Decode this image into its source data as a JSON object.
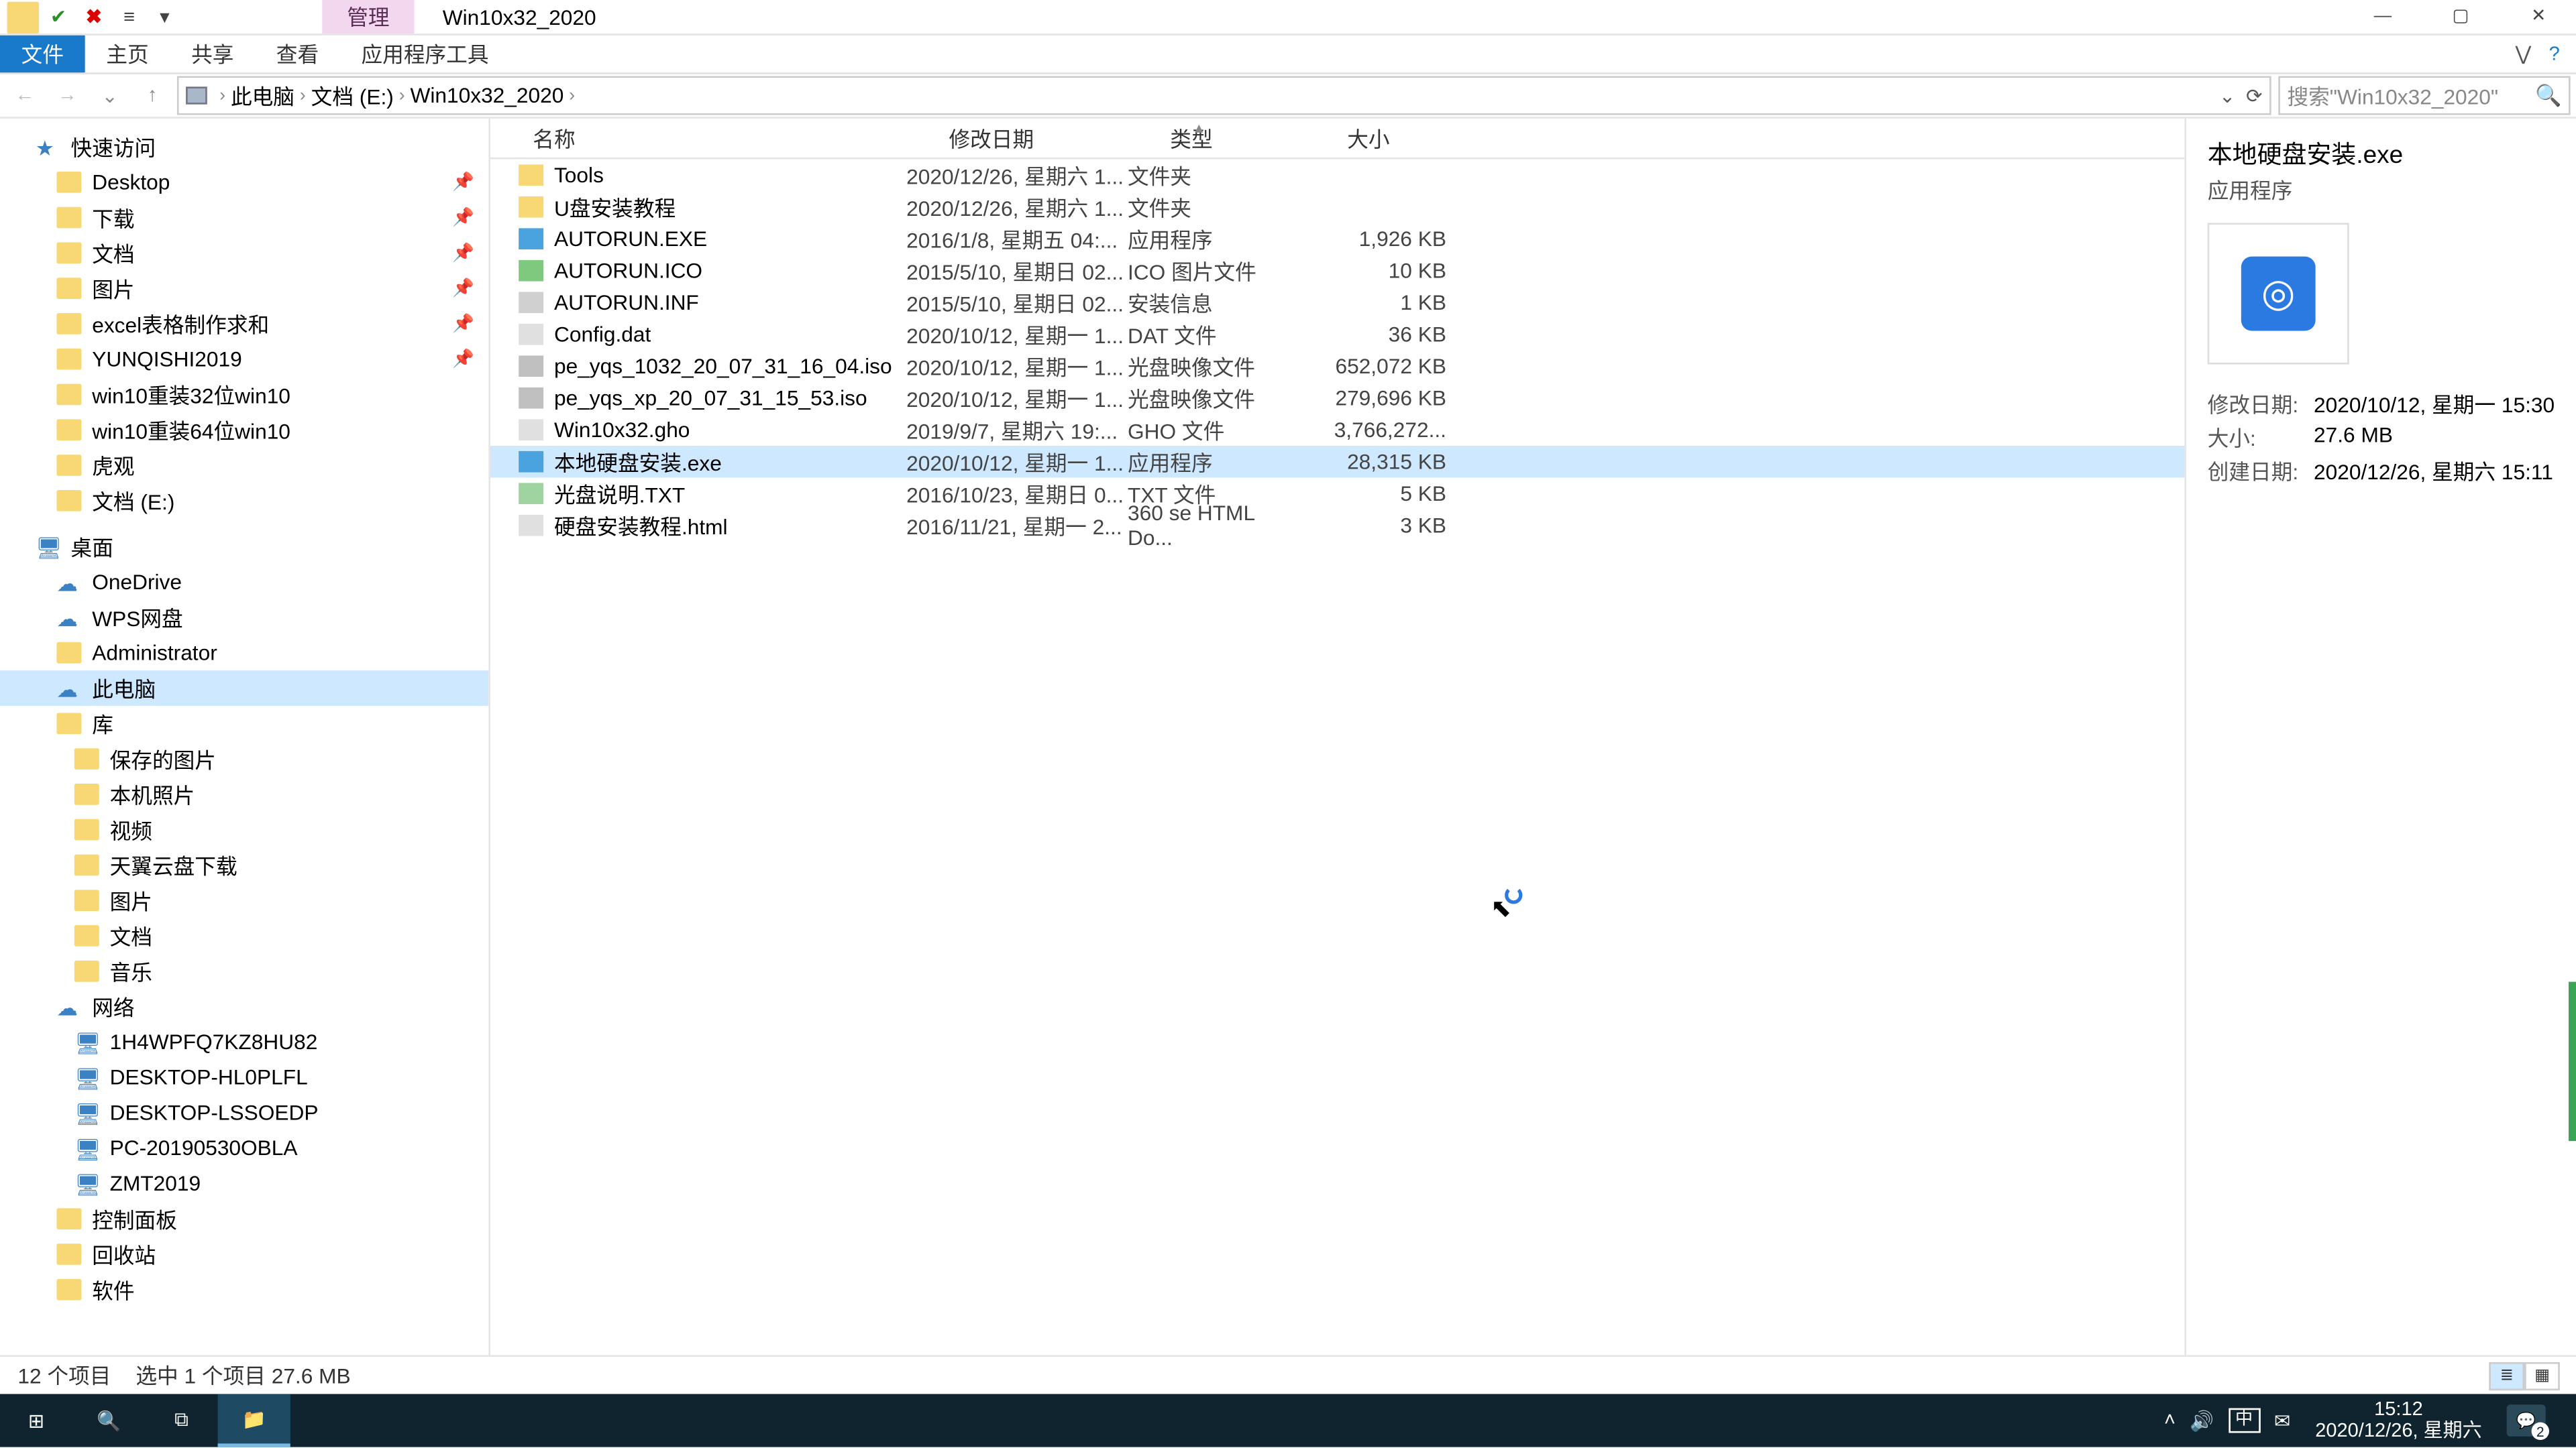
{
  "titlebar": {
    "manage": "管理",
    "title": "Win10x32_2020",
    "min": "—",
    "max": "▢",
    "close": "✕"
  },
  "ribbon": {
    "file": "文件",
    "tabs": [
      "主页",
      "共享",
      "查看",
      "应用程序工具"
    ],
    "expand_caret": "⋁",
    "help": "?"
  },
  "nav": {
    "back": "←",
    "forward": "→",
    "dropdown": "⌄",
    "up": "↑"
  },
  "address": {
    "crumbs": [
      "此电脑",
      "文档 (E:)",
      "Win10x32_2020"
    ],
    "refresh": "⟳",
    "dropdown": "⌄"
  },
  "search": {
    "placeholder": "搜索\"Win10x32_2020\"",
    "icon": "🔍"
  },
  "columns": {
    "name": "名称",
    "date": "修改日期",
    "type": "类型",
    "size": "大小"
  },
  "tree": {
    "quick": "快速访问",
    "quick_items": [
      {
        "label": "Desktop",
        "pin": true
      },
      {
        "label": "下载",
        "pin": true
      },
      {
        "label": "文档",
        "pin": true
      },
      {
        "label": "图片",
        "pin": true
      },
      {
        "label": "excel表格制作求和",
        "pin": true
      },
      {
        "label": "YUNQISHI2019",
        "pin": true
      },
      {
        "label": "win10重装32位win10",
        "pin": false
      },
      {
        "label": "win10重装64位win10",
        "pin": false
      },
      {
        "label": "虎观",
        "pin": false
      },
      {
        "label": "文档 (E:)",
        "pin": false
      }
    ],
    "desktop": "桌面",
    "desktop_items": [
      "OneDrive",
      "WPS网盘",
      "Administrator",
      "此电脑",
      "库",
      "保存的图片",
      "本机照片",
      "视频",
      "天翼云盘下载",
      "图片",
      "文档",
      "音乐",
      "网络"
    ],
    "network_items": [
      "1H4WPFQ7KZ8HU82",
      "DESKTOP-HL0PLFL",
      "DESKTOP-LSSOEDP",
      "PC-20190530OBLA",
      "ZMT2019"
    ],
    "extras": [
      "控制面板",
      "回收站",
      "软件"
    ]
  },
  "files": [
    {
      "name": "Tools",
      "date": "2020/12/26, 星期六 1...",
      "type": "文件夹",
      "size": "",
      "ic": "fic-folder"
    },
    {
      "name": "U盘安装教程",
      "date": "2020/12/26, 星期六 1...",
      "type": "文件夹",
      "size": "",
      "ic": "fic-folder"
    },
    {
      "name": "AUTORUN.EXE",
      "date": "2016/1/8, 星期五 04:...",
      "type": "应用程序",
      "size": "1,926 KB",
      "ic": "fic-exe"
    },
    {
      "name": "AUTORUN.ICO",
      "date": "2015/5/10, 星期日 02...",
      "type": "ICO 图片文件",
      "size": "10 KB",
      "ic": "fic-ico"
    },
    {
      "name": "AUTORUN.INF",
      "date": "2015/5/10, 星期日 02...",
      "type": "安装信息",
      "size": "1 KB",
      "ic": "fic-inf"
    },
    {
      "name": "Config.dat",
      "date": "2020/10/12, 星期一 1...",
      "type": "DAT 文件",
      "size": "36 KB",
      "ic": "fic-dat"
    },
    {
      "name": "pe_yqs_1032_20_07_31_16_04.iso",
      "date": "2020/10/12, 星期一 1...",
      "type": "光盘映像文件",
      "size": "652,072 KB",
      "ic": "fic-iso"
    },
    {
      "name": "pe_yqs_xp_20_07_31_15_53.iso",
      "date": "2020/10/12, 星期一 1...",
      "type": "光盘映像文件",
      "size": "279,696 KB",
      "ic": "fic-iso"
    },
    {
      "name": "Win10x32.gho",
      "date": "2019/9/7, 星期六 19:...",
      "type": "GHO 文件",
      "size": "3,766,272...",
      "ic": "fic-gho"
    },
    {
      "name": "本地硬盘安装.exe",
      "date": "2020/10/12, 星期一 1...",
      "type": "应用程序",
      "size": "28,315 KB",
      "ic": "fic-exe",
      "selected": true
    },
    {
      "name": "光盘说明.TXT",
      "date": "2016/10/23, 星期日 0...",
      "type": "TXT 文件",
      "size": "5 KB",
      "ic": "fic-txt"
    },
    {
      "name": "硬盘安装教程.html",
      "date": "2016/11/21, 星期一 2...",
      "type": "360 se HTML Do...",
      "size": "3 KB",
      "ic": "fic-html"
    }
  ],
  "preview": {
    "title": "本地硬盘安装.exe",
    "subtitle": "应用程序",
    "mdate_k": "修改日期:",
    "mdate_v": "2020/10/12, 星期一 15:30",
    "size_k": "大小:",
    "size_v": "27.6 MB",
    "cdate_k": "创建日期:",
    "cdate_v": "2020/12/26, 星期六 15:11"
  },
  "status": {
    "count": "12 个项目",
    "selected": "选中 1 个项目  27.6 MB"
  },
  "taskbar": {
    "start": "⊞",
    "search": "🔍",
    "taskview": "⧉",
    "explorer": "📁",
    "tray_up": "˄",
    "vol": "🔊",
    "ime": "中",
    "wifi": "✉",
    "time": "15:12",
    "date": "2020/12/26, 星期六",
    "notif_badge": "2"
  }
}
